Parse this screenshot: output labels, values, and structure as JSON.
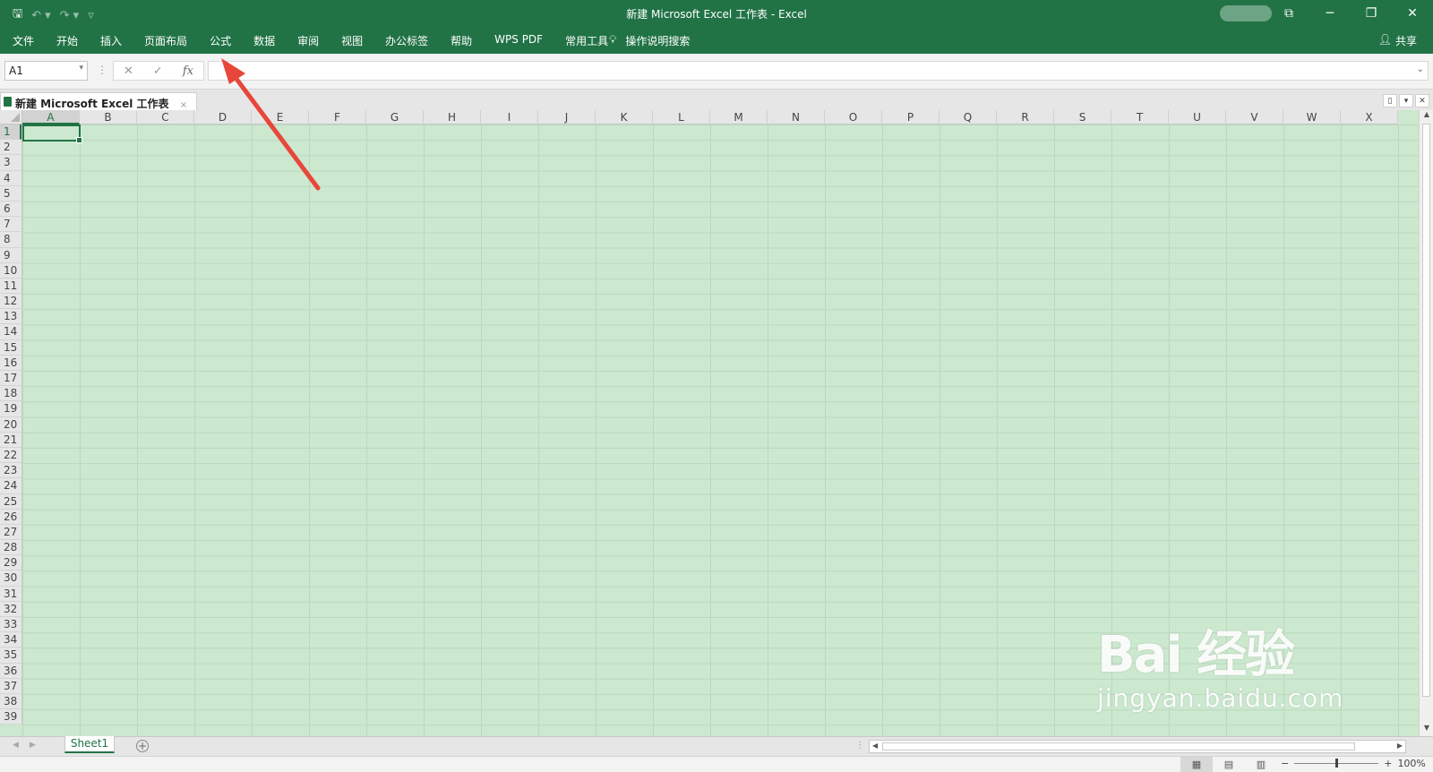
{
  "title_bar": {
    "title": "新建 Microsoft Excel 工作表  -  Excel",
    "save_icon": "save-icon",
    "undo_icon": "undo-icon",
    "redo_icon": "redo-icon",
    "customize_icon": "customize-qat-icon"
  },
  "ribbon": {
    "tabs": [
      "文件",
      "开始",
      "插入",
      "页面布局",
      "公式",
      "数据",
      "审阅",
      "视图",
      "办公标签",
      "帮助",
      "WPS PDF",
      "常用工具"
    ],
    "tell_me": "操作说明搜索",
    "share": "共享"
  },
  "formula_bar": {
    "name_box": "A1",
    "fx": "fx",
    "value": ""
  },
  "workbook": {
    "tab_title": "新建 Microsoft Excel 工作表",
    "columns": [
      "A",
      "B",
      "C",
      "D",
      "E",
      "F",
      "G",
      "H",
      "I",
      "J",
      "K",
      "L",
      "M",
      "N",
      "O",
      "P",
      "Q",
      "R",
      "S",
      "T",
      "U",
      "V",
      "W",
      "X"
    ],
    "rows": [
      "1",
      "2",
      "3",
      "4",
      "5",
      "6",
      "7",
      "8",
      "9",
      "10",
      "11",
      "12",
      "13",
      "14",
      "15",
      "16",
      "17",
      "18",
      "19",
      "20",
      "21",
      "22",
      "23",
      "24",
      "25",
      "26",
      "27",
      "28",
      "29",
      "30",
      "31",
      "32",
      "33",
      "34",
      "35",
      "36",
      "37",
      "38",
      "39"
    ],
    "active_cell": "A1",
    "cell_background": "#cce8cf"
  },
  "sheets": {
    "tabs": [
      "Sheet1"
    ],
    "active": "Sheet1"
  },
  "status_bar": {
    "zoom": "100%"
  },
  "watermark": {
    "brand": "Bai  经验",
    "url": "jingyan.baidu.com"
  },
  "colors": {
    "accent": "#217346",
    "arrow": "#e8463a"
  }
}
